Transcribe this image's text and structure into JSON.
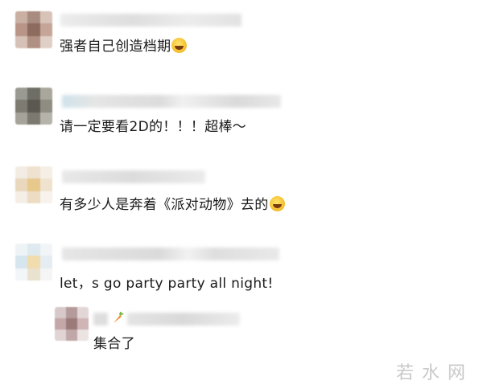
{
  "comments": [
    {
      "text": "强者自己创造档期",
      "emoji": "laughing-tears-emoji"
    },
    {
      "text": "请一定要看2D的！！！超棒～"
    },
    {
      "text": "有多少人是奔着《派对动物》去的",
      "emoji": "laughing-tears-emoji"
    },
    {
      "text": "let，s  go  party party all night!"
    }
  ],
  "reply": {
    "text": "集合了",
    "badge_icon": "carrot-icon"
  },
  "watermark": "若水网",
  "colors": {
    "text": "#1a1a1a",
    "blur_gray": "#e6e6e6",
    "watermark": "#c9c9c9"
  }
}
